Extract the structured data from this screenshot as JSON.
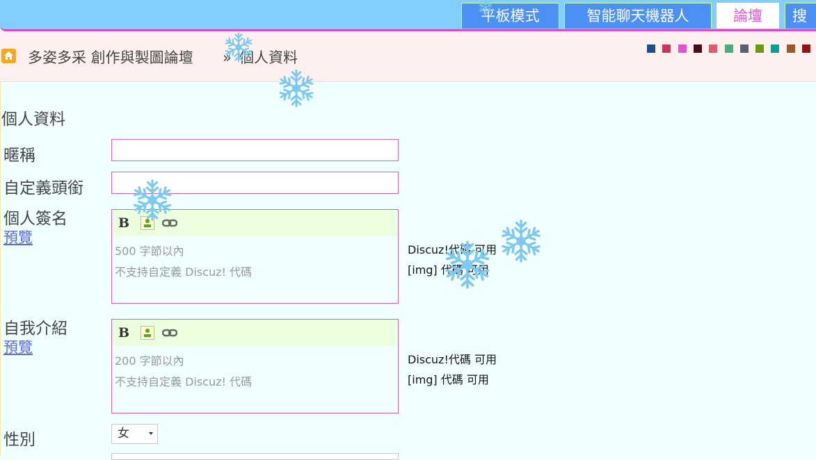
{
  "nav": {
    "tabs": [
      {
        "label": "平板模式"
      },
      {
        "label": "智能聊天機器人"
      },
      {
        "label": "論壇",
        "active": true
      },
      {
        "label": "搜"
      }
    ]
  },
  "breadcrumb": {
    "site": "多姿多采 創作與製圖論壇",
    "separator": "»",
    "current": "個人資料"
  },
  "theme_swatches": [
    "#1f4e8c",
    "#cc3366",
    "#e84fd0",
    "#4a0d1a",
    "#e05a6a",
    "#4faa80",
    "#5a6070",
    "#6a9a10",
    "#0aa090",
    "#9a5a30",
    "#9a0f10",
    "#2a2a2a"
  ],
  "form": {
    "section_title": "個人資料",
    "nickname": {
      "label": "暱稱",
      "value": ""
    },
    "custom_title": {
      "label": "自定義頭銜",
      "value": ""
    },
    "signature": {
      "label": "個人簽名",
      "preview": "預覽",
      "limit_number": "500",
      "limit_text": "字節以內",
      "hint2": "不支持自定義 Discuz! 代碼",
      "note1": "Discuz!代碼 可用",
      "note2": "[img] 代碼 可用"
    },
    "bio": {
      "label": "自我介紹",
      "preview": "預覽",
      "limit_number": "200",
      "limit_text": "字節以內",
      "hint2": "不支持自定義 Discuz! 代碼",
      "note1": "Discuz!代碼 可用",
      "note2": "[img] 代碼 可用"
    },
    "gender": {
      "label": "性別",
      "selected": "女"
    }
  },
  "editor_tools": {
    "bold": "B"
  }
}
